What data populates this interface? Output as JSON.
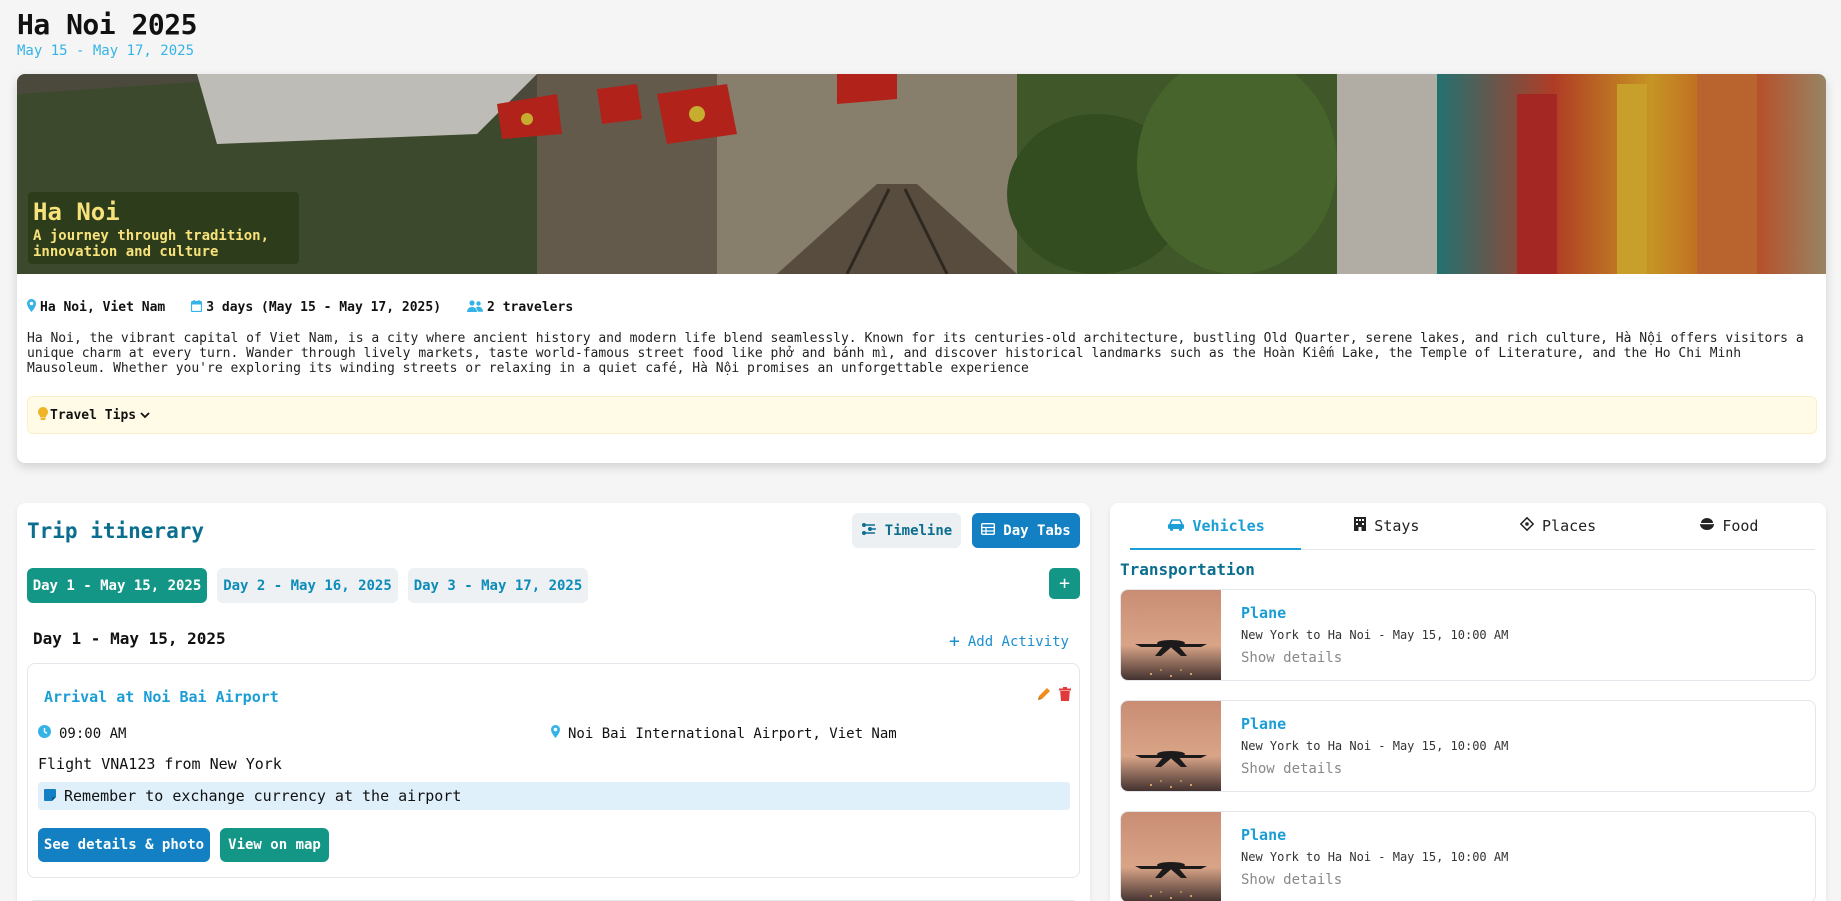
{
  "page": {
    "title": "Ha Noi 2025",
    "dates": "May 15 - May 17, 2025"
  },
  "hero": {
    "title": "Ha Noi",
    "subtitle": "A journey through tradition, innovation and culture",
    "location": "Ha Noi, Viet Nam",
    "duration": "3 days (May 15 - May 17, 2025)",
    "travelers": "2 travelers",
    "description": "Ha Noi, the vibrant capital of Viet Nam, is a city where ancient history and modern life blend seamlessly. Known for its centuries-old architecture, bustling Old Quarter, serene lakes, and rich culture, Hà Nội offers visitors a unique charm at every turn. Wander through lively markets, taste world-famous street food like phở and bánh mì, and discover historical landmarks such as the Hoàn Kiếm Lake, the Temple of Literature, and the Ho Chi Minh Mausoleum. Whether you're exploring its winding streets or relaxing in a quiet café, Hà Nội promises an unforgettable experience",
    "tips_label": "Travel Tips"
  },
  "itinerary": {
    "title": "Trip itinerary",
    "view_timeline": "Timeline",
    "view_tabs": "Day Tabs",
    "add_day": "+",
    "days": [
      {
        "label": "Day 1 - May 15, 2025"
      },
      {
        "label": "Day 2 - May 16, 2025"
      },
      {
        "label": "Day 3 - May 17, 2025"
      }
    ],
    "day_heading": "Day 1 - May 15, 2025",
    "add_activity": "Add Activity",
    "activity": {
      "title": "Arrival at Noi Bai Airport",
      "time": "09:00 AM",
      "location": "Noi Bai International Airport, Viet Nam",
      "description": "Flight VNA123 from New York",
      "note": "Remember to exchange currency at the airport",
      "details_button": "See details & photo",
      "map_button": "View on map"
    }
  },
  "sidebar": {
    "tabs": [
      {
        "label": "Vehicles",
        "icon": "car-icon"
      },
      {
        "label": "Stays",
        "icon": "hotel-icon"
      },
      {
        "label": "Places",
        "icon": "location-diamond-icon"
      },
      {
        "label": "Food",
        "icon": "food-bowl-icon"
      }
    ],
    "section_title": "Transportation",
    "vehicles": [
      {
        "name": "Plane",
        "route": "New York to Ha Noi - May 15, 10:00 AM",
        "more": "Show details"
      },
      {
        "name": "Plane",
        "route": "New York to Ha Noi - May 15, 10:00 AM",
        "more": "Show details"
      },
      {
        "name": "Plane",
        "route": "New York to Ha Noi - May 15, 10:00 AM",
        "more": "Show details"
      }
    ]
  },
  "colors": {
    "accent_teal": "#139686",
    "accent_blue": "#1480c4",
    "link_blue": "#1b9ed6",
    "heading_blue": "#0b6e8f",
    "date_blue": "#36b3e6"
  }
}
